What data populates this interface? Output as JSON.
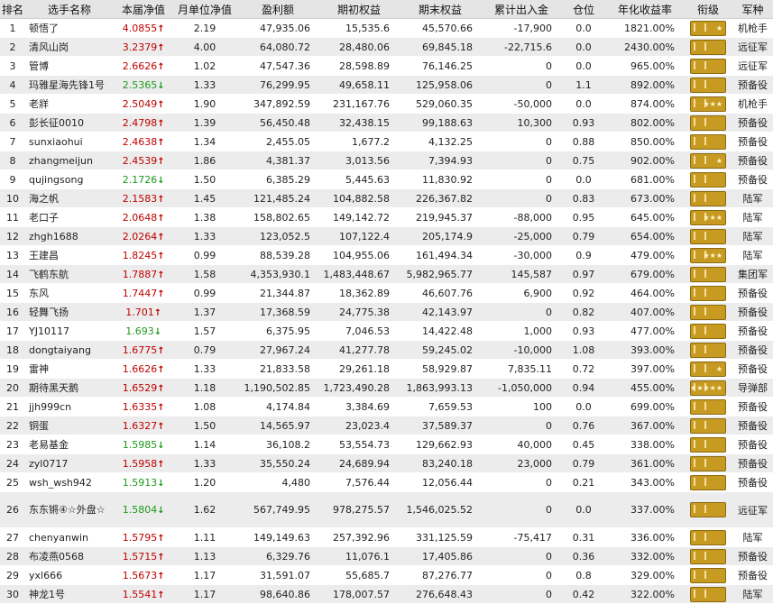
{
  "headers": [
    "排名",
    "选手名称",
    "本届净值",
    "月单位净值",
    "盈利额",
    "期初权益",
    "期末权益",
    "累计出入金",
    "仓位",
    "年化收益率",
    "衔级",
    "军种"
  ],
  "rows": [
    {
      "rank": "1",
      "name": "顿悟了",
      "nav": "4.0855",
      "dir": "up",
      "month": "2.19",
      "profit": "47,935.06",
      "start": "15,535.6",
      "end": "45,570.66",
      "flow": "-17,900",
      "pos": "0.0",
      "annual": "1821.00%",
      "badge": "★",
      "branch": "机枪手"
    },
    {
      "rank": "2",
      "name": "清风山岗",
      "nav": "3.2379",
      "dir": "up",
      "month": "4.00",
      "profit": "64,080.72",
      "start": "28,480.06",
      "end": "69,845.18",
      "flow": "-22,715.6",
      "pos": "0.0",
      "annual": "2430.00%",
      "badge": "",
      "branch": "远征军"
    },
    {
      "rank": "3",
      "name": "管博",
      "nav": "2.6626",
      "dir": "up",
      "month": "1.02",
      "profit": "47,547.36",
      "start": "28,598.89",
      "end": "76,146.25",
      "flow": "0",
      "pos": "0.0",
      "annual": "965.00%",
      "badge": "",
      "branch": "远征军"
    },
    {
      "rank": "4",
      "name": "玛雅星海先锋1号",
      "nav": "2.5365",
      "dir": "down",
      "month": "1.33",
      "profit": "76,299.95",
      "start": "49,658.11",
      "end": "125,958.06",
      "flow": "0",
      "pos": "1.1",
      "annual": "892.00%",
      "badge": "",
      "branch": "预备役"
    },
    {
      "rank": "5",
      "name": "老牂",
      "nav": "2.5049",
      "dir": "up",
      "month": "1.90",
      "profit": "347,892.59",
      "start": "231,167.76",
      "end": "529,060.35",
      "flow": "-50,000",
      "pos": "0.0",
      "annual": "874.00%",
      "badge": "★★★",
      "branch": "机枪手"
    },
    {
      "rank": "6",
      "name": "彭长征0010",
      "nav": "2.4798",
      "dir": "up",
      "month": "1.39",
      "profit": "56,450.48",
      "start": "32,438.15",
      "end": "99,188.63",
      "flow": "10,300",
      "pos": "0.93",
      "annual": "802.00%",
      "badge": "",
      "branch": "预备役"
    },
    {
      "rank": "7",
      "name": "sunxiaohui",
      "nav": "2.4638",
      "dir": "up",
      "month": "1.34",
      "profit": "2,455.05",
      "start": "1,677.2",
      "end": "4,132.25",
      "flow": "0",
      "pos": "0.88",
      "annual": "850.00%",
      "badge": "",
      "branch": "预备役"
    },
    {
      "rank": "8",
      "name": "zhangmeijun",
      "nav": "2.4539",
      "dir": "up",
      "month": "1.86",
      "profit": "4,381.37",
      "start": "3,013.56",
      "end": "7,394.93",
      "flow": "0",
      "pos": "0.75",
      "annual": "902.00%",
      "badge": "★",
      "branch": "预备役"
    },
    {
      "rank": "9",
      "name": "qujingsong",
      "nav": "2.1726",
      "dir": "down",
      "month": "1.50",
      "profit": "6,385.29",
      "start": "5,445.63",
      "end": "11,830.92",
      "flow": "0",
      "pos": "0.0",
      "annual": "681.00%",
      "badge": "",
      "branch": "预备役"
    },
    {
      "rank": "10",
      "name": "海之帆",
      "nav": "2.1583",
      "dir": "up",
      "month": "1.45",
      "profit": "121,485.24",
      "start": "104,882.58",
      "end": "226,367.82",
      "flow": "0",
      "pos": "0.83",
      "annual": "673.00%",
      "badge": "",
      "branch": "陆军"
    },
    {
      "rank": "11",
      "name": "老口子",
      "nav": "2.0648",
      "dir": "up",
      "month": "1.38",
      "profit": "158,802.65",
      "start": "149,142.72",
      "end": "219,945.37",
      "flow": "-88,000",
      "pos": "0.95",
      "annual": "645.00%",
      "badge": "★★★",
      "branch": "陆军"
    },
    {
      "rank": "12",
      "name": "zhgh1688",
      "nav": "2.0264",
      "dir": "up",
      "month": "1.33",
      "profit": "123,052.5",
      "start": "107,122.4",
      "end": "205,174.9",
      "flow": "-25,000",
      "pos": "0.79",
      "annual": "654.00%",
      "badge": "",
      "branch": "陆军"
    },
    {
      "rank": "13",
      "name": "王建昌",
      "nav": "1.8245",
      "dir": "up",
      "month": "0.99",
      "profit": "88,539.28",
      "start": "104,955.06",
      "end": "161,494.34",
      "flow": "-30,000",
      "pos": "0.9",
      "annual": "479.00%",
      "badge": "★★★",
      "branch": "陆军"
    },
    {
      "rank": "14",
      "name": "飞鹤东航",
      "nav": "1.7887",
      "dir": "up",
      "month": "1.58",
      "profit": "4,353,930.1",
      "start": "1,483,448.67",
      "end": "5,982,965.77",
      "flow": "145,587",
      "pos": "0.97",
      "annual": "679.00%",
      "badge": "",
      "branch": "集团军"
    },
    {
      "rank": "15",
      "name": "东风",
      "nav": "1.7447",
      "dir": "up",
      "month": "0.99",
      "profit": "21,344.87",
      "start": "18,362.89",
      "end": "46,607.76",
      "flow": "6,900",
      "pos": "0.92",
      "annual": "464.00%",
      "badge": "",
      "branch": "预备役"
    },
    {
      "rank": "16",
      "name": "轻舞飞扬",
      "nav": "1.701",
      "dir": "up",
      "month": "1.37",
      "profit": "17,368.59",
      "start": "24,775.38",
      "end": "42,143.97",
      "flow": "0",
      "pos": "0.82",
      "annual": "407.00%",
      "badge": "",
      "branch": "预备役"
    },
    {
      "rank": "17",
      "name": "YJ10117",
      "nav": "1.693",
      "dir": "down",
      "month": "1.57",
      "profit": "6,375.95",
      "start": "7,046.53",
      "end": "14,422.48",
      "flow": "1,000",
      "pos": "0.93",
      "annual": "477.00%",
      "badge": "",
      "branch": "预备役"
    },
    {
      "rank": "18",
      "name": "dongtaiyang",
      "nav": "1.6775",
      "dir": "up",
      "month": "0.79",
      "profit": "27,967.24",
      "start": "41,277.78",
      "end": "59,245.02",
      "flow": "-10,000",
      "pos": "1.08",
      "annual": "393.00%",
      "badge": "",
      "branch": "预备役"
    },
    {
      "rank": "19",
      "name": "雷神",
      "nav": "1.6626",
      "dir": "up",
      "month": "1.33",
      "profit": "21,833.58",
      "start": "29,261.18",
      "end": "58,929.87",
      "flow": "7,835.11",
      "pos": "0.72",
      "annual": "397.00%",
      "badge": "★",
      "branch": "预备役"
    },
    {
      "rank": "20",
      "name": "期待黑天鹅",
      "nav": "1.6529",
      "dir": "up",
      "month": "1.18",
      "profit": "1,190,502.85",
      "start": "1,723,490.28",
      "end": "1,863,993.13",
      "flow": "-1,050,000",
      "pos": "0.94",
      "annual": "455.00%",
      "badge": "★★★★★",
      "branch": "导弹部"
    },
    {
      "rank": "21",
      "name": "jjh999cn",
      "nav": "1.6335",
      "dir": "up",
      "month": "1.08",
      "profit": "4,174.84",
      "start": "3,384.69",
      "end": "7,659.53",
      "flow": "100",
      "pos": "0.0",
      "annual": "699.00%",
      "badge": "",
      "branch": "预备役"
    },
    {
      "rank": "22",
      "name": "铜蛋",
      "nav": "1.6327",
      "dir": "up",
      "month": "1.50",
      "profit": "14,565.97",
      "start": "23,023.4",
      "end": "37,589.37",
      "flow": "0",
      "pos": "0.76",
      "annual": "367.00%",
      "badge": "",
      "branch": "预备役"
    },
    {
      "rank": "23",
      "name": "老易基金",
      "nav": "1.5985",
      "dir": "down",
      "month": "1.14",
      "profit": "36,108.2",
      "start": "53,554.73",
      "end": "129,662.93",
      "flow": "40,000",
      "pos": "0.45",
      "annual": "338.00%",
      "badge": "",
      "branch": "预备役"
    },
    {
      "rank": "24",
      "name": "zyl0717",
      "nav": "1.5958",
      "dir": "up",
      "month": "1.33",
      "profit": "35,550.24",
      "start": "24,689.94",
      "end": "83,240.18",
      "flow": "23,000",
      "pos": "0.79",
      "annual": "361.00%",
      "badge": "",
      "branch": "预备役"
    },
    {
      "rank": "25",
      "name": "wsh_wsh942",
      "nav": "1.5913",
      "dir": "down",
      "month": "1.20",
      "profit": "4,480",
      "start": "7,576.44",
      "end": "12,056.44",
      "flow": "0",
      "pos": "0.21",
      "annual": "343.00%",
      "badge": "",
      "branch": "预备役"
    },
    {
      "rank": "26",
      "name": "东东锵④☆外盘☆",
      "nav": "1.5804",
      "dir": "down",
      "month": "1.62",
      "profit": "567,749.95",
      "start": "978,275.57",
      "end": "1,546,025.52",
      "flow": "0",
      "pos": "0.0",
      "annual": "337.00%",
      "badge": "",
      "branch": "远征军"
    },
    {
      "rank": "27",
      "name": "chenyanwin",
      "nav": "1.5795",
      "dir": "up",
      "month": "1.11",
      "profit": "149,149.63",
      "start": "257,392.96",
      "end": "331,125.59",
      "flow": "-75,417",
      "pos": "0.31",
      "annual": "336.00%",
      "badge": "",
      "branch": "陆军"
    },
    {
      "rank": "28",
      "name": "布凌燕0568",
      "nav": "1.5715",
      "dir": "up",
      "month": "1.13",
      "profit": "6,329.76",
      "start": "11,076.1",
      "end": "17,405.86",
      "flow": "0",
      "pos": "0.36",
      "annual": "332.00%",
      "badge": "",
      "branch": "预备役"
    },
    {
      "rank": "29",
      "name": "yxl666",
      "nav": "1.5673",
      "dir": "up",
      "month": "1.17",
      "profit": "31,591.07",
      "start": "55,685.7",
      "end": "87,276.77",
      "flow": "0",
      "pos": "0.8",
      "annual": "329.00%",
      "badge": "",
      "branch": "预备役"
    },
    {
      "rank": "30",
      "name": "神龙1号",
      "nav": "1.5541",
      "dir": "up",
      "month": "1.17",
      "profit": "98,640.86",
      "start": "178,007.57",
      "end": "276,648.43",
      "flow": "0",
      "pos": "0.42",
      "annual": "322.00%",
      "badge": "",
      "branch": "陆军"
    }
  ],
  "colors": {
    "up": "#c00000",
    "down": "#1a9a1a",
    "badge": "#c79a22",
    "header_bg": "#e5e5e5",
    "row_alt": "#ececec"
  },
  "icons": {
    "up": "arrow-up-icon",
    "down": "arrow-down-icon",
    "badge": "rank-insignia-icon"
  }
}
